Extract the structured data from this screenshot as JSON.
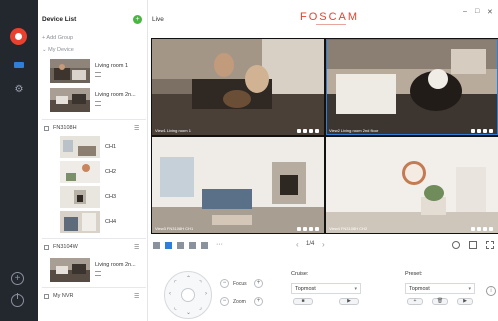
{
  "topbar": {
    "section": "Live",
    "brand": "FOSCAM",
    "minimize": "–",
    "maximize": "□",
    "close": "✕"
  },
  "device_panel": {
    "title": "Device List",
    "add_group": "+ Add Group",
    "my_device": "⌄ My Device",
    "devices": [
      {
        "name": "Living room 1"
      },
      {
        "name": "Living room 2n..."
      }
    ],
    "nvrs": [
      {
        "name": "FN3108H",
        "channels": [
          "CH1",
          "CH2",
          "CH3",
          "CH4"
        ]
      },
      {
        "name": "FN3104W",
        "devices": [
          {
            "name": "Living room 2n..."
          }
        ]
      },
      {
        "name": "My NVR"
      }
    ],
    "menu_glyph": "☰"
  },
  "video": {
    "tiles": [
      {
        "caption": "View1 Living room 1"
      },
      {
        "caption": "View2 Living room 2nd floor"
      },
      {
        "caption": "View3 FN3108H CH1"
      },
      {
        "caption": "View4 FN3108H CH2"
      }
    ]
  },
  "toolbar": {
    "more": "···",
    "prev": "‹",
    "page": "1/4",
    "next": "›"
  },
  "ptz": {
    "focus_label": "Focus",
    "zoom_label": "Zoom",
    "minus": "−",
    "plus": "+"
  },
  "cruise": {
    "label": "Cruise:",
    "selected": "Topmost",
    "stop": "■",
    "play": "▶"
  },
  "preset": {
    "label": "Preset:",
    "selected": "Topmost",
    "add": "+",
    "delete": "🗑",
    "go": "▶"
  },
  "info_glyph": "i",
  "colors": {
    "brand": "#e8412f",
    "accent": "#2f7fd8",
    "add_green": "#4bb543",
    "rail": "#23272e"
  }
}
